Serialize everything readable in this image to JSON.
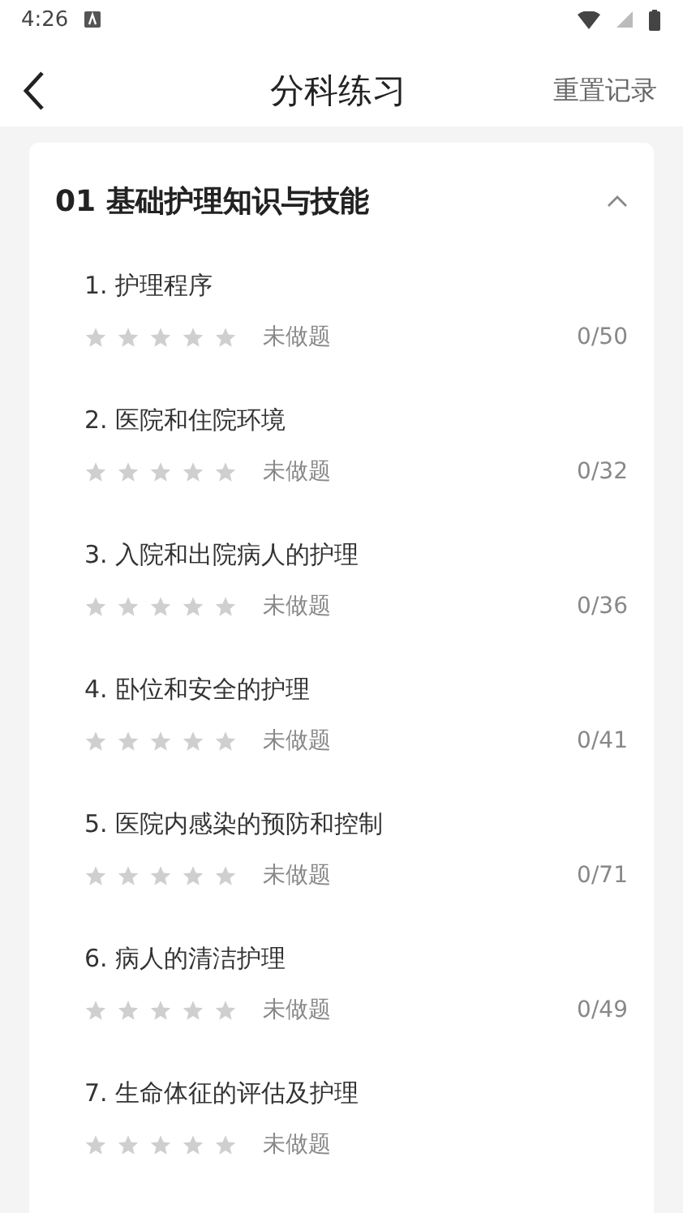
{
  "status_bar": {
    "time": "4:26"
  },
  "header": {
    "title": "分科练习",
    "action": "重置记录"
  },
  "groups": [
    {
      "title": "01 基础护理知识与技能",
      "expanded": true,
      "items": [
        {
          "title": "1. 护理程序",
          "stars": 0,
          "status": "未做题",
          "count": "0/50"
        },
        {
          "title": "2. 医院和住院环境",
          "stars": 0,
          "status": "未做题",
          "count": "0/32"
        },
        {
          "title": "3. 入院和出院病人的护理",
          "stars": 0,
          "status": "未做题",
          "count": "0/36"
        },
        {
          "title": "4. 卧位和安全的护理",
          "stars": 0,
          "status": "未做题",
          "count": "0/41"
        },
        {
          "title": "5. 医院内感染的预防和控制",
          "stars": 0,
          "status": "未做题",
          "count": "0/71"
        },
        {
          "title": "6. 病人的清洁护理",
          "stars": 0,
          "status": "未做题",
          "count": "0/49"
        },
        {
          "title": "7. 生命体征的评估及护理",
          "stars": 0,
          "status": "未做题"
        }
      ]
    }
  ]
}
